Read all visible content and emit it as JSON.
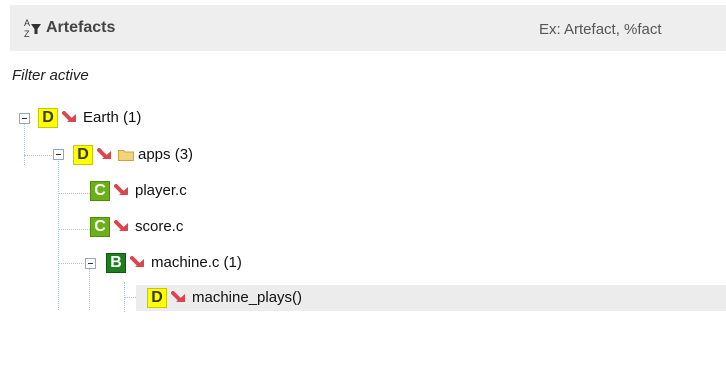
{
  "panel": {
    "title": "Artefacts",
    "search_placeholder": "Ex: Artefact, %fact",
    "search_value": "",
    "filter_status": "Filter active"
  },
  "colors": {
    "grade_D": "#ffff00",
    "grade_C": "#6ab117",
    "grade_B": "#1e7d1e",
    "trend_down": "#d9464e",
    "folder": "#f4d37b"
  },
  "tree": [
    {
      "label": "Earth (1)",
      "grade": "D",
      "trend_icon": "trend-down-arrow-icon",
      "type": "project",
      "expanded": true
    },
    {
      "label": "apps (3)",
      "grade": "D",
      "trend_icon": "trend-down-arrow-icon",
      "type": "folder",
      "expanded": true
    },
    {
      "label": "player.c",
      "grade": "C",
      "trend_icon": "trend-down-arrow-icon",
      "type": "file"
    },
    {
      "label": "score.c",
      "grade": "C",
      "trend_icon": "trend-down-arrow-icon",
      "type": "file"
    },
    {
      "label": "machine.c (1)",
      "grade": "B",
      "trend_icon": "trend-down-arrow-icon",
      "type": "file",
      "expanded": true
    },
    {
      "label": "machine_plays()",
      "grade": "D",
      "trend_icon": "trend-down-arrow-icon",
      "type": "function",
      "selected": true
    }
  ]
}
